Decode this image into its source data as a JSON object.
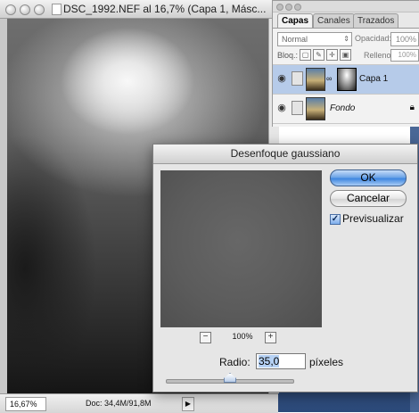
{
  "document": {
    "title": "DSC_1992.NEF al 16,7% (Capa 1, Másc...",
    "status_zoom": "16,67%",
    "status_doc": "Doc: 34,4M/91,8M"
  },
  "layers_panel": {
    "tabs": [
      {
        "label": "Capas",
        "active": true
      },
      {
        "label": "Canales",
        "active": false
      },
      {
        "label": "Trazados",
        "active": false
      }
    ],
    "blend_mode": "Normal",
    "opacity_label": "Opacidad:",
    "opacity_value": "100%",
    "lock_label": "Bloq.:",
    "fill_label": "Relleno:",
    "fill_value": "100%",
    "layers": [
      {
        "name": "Capa 1",
        "selected": true,
        "has_mask": true
      },
      {
        "name": "Fondo",
        "selected": false,
        "locked": true
      }
    ]
  },
  "dialog": {
    "title": "Desenfoque gaussiano",
    "ok_label": "OK",
    "cancel_label": "Cancelar",
    "preview_label": "Previsualizar",
    "preview_checked": true,
    "zoom_minus": "−",
    "zoom_plus": "+",
    "zoom_level": "100%",
    "radius_label": "Radio:",
    "radius_value": "35,0",
    "radius_unit": "píxeles",
    "radius_slider_fraction": 0.5
  },
  "colors": {
    "selected_layer": "#b6cbe9",
    "ok_button": "#3f86e0",
    "desktop": "#3f5e92"
  },
  "icons": {
    "eye": "eye-icon",
    "chain": "chain-link-icon",
    "lock": "lock-icon",
    "checkbox": "checkmark-icon"
  }
}
